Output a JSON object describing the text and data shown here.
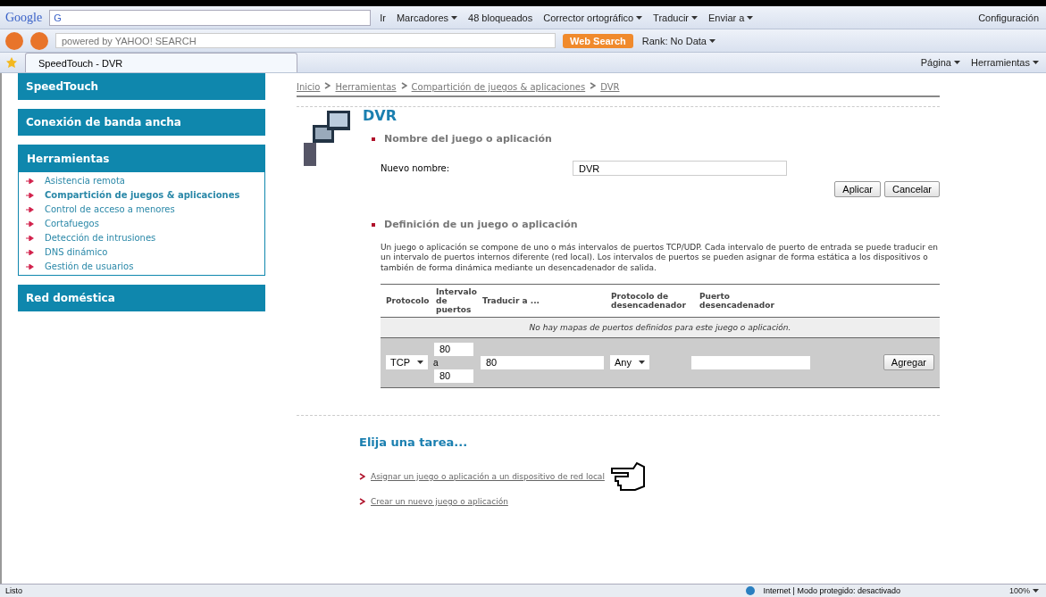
{
  "google_toolbar": {
    "logo": "Google",
    "search_label": "G",
    "go": "Ir",
    "items": [
      {
        "kind": "menu",
        "label": "Marcadores"
      },
      {
        "kind": "plain",
        "label": "48 bloqueados"
      },
      {
        "kind": "menu",
        "label": "Corrector ortográfico"
      },
      {
        "kind": "menu",
        "label": "Traducir"
      },
      {
        "kind": "menu",
        "label": "Enviar a"
      }
    ],
    "settings": "Configuración"
  },
  "yahoo_toolbar": {
    "search_placeholder": "powered by YAHOO! SEARCH",
    "search_button": "Web Search",
    "rank": "Rank: No Data"
  },
  "tab_bar": {
    "tabs": [
      {
        "label": "SpeedTouch - DVR",
        "selected": true
      }
    ],
    "commands": [
      "Página",
      "Herramientas"
    ]
  },
  "sidebar": {
    "sections": [
      {
        "title": "SpeedTouch",
        "expanded": false
      },
      {
        "title": "Conexión de banda ancha",
        "expanded": false
      },
      {
        "title": "Herramientas",
        "expanded": true,
        "items": [
          {
            "label": "Asistencia remota",
            "selected": false
          },
          {
            "label": "Compartición de juegos & aplicaciones",
            "selected": true
          },
          {
            "label": "Control de acceso a menores",
            "selected": false
          },
          {
            "label": "Cortafuegos",
            "selected": false
          },
          {
            "label": "Detección de intrusiones",
            "selected": false
          },
          {
            "label": "DNS dinámico",
            "selected": false
          },
          {
            "label": "Gestión de usuarios",
            "selected": false
          }
        ]
      },
      {
        "title": "Red doméstica",
        "expanded": false
      }
    ]
  },
  "breadcrumb": [
    "Inicio",
    "Herramientas",
    "Compartición de juegos & aplicaciones",
    "DVR"
  ],
  "page_title": "DVR",
  "name_section": {
    "heading": "Nombre del juego o aplicación",
    "label": "Nuevo nombre:",
    "value": "DVR",
    "buttons": [
      "Aplicar",
      "Cancelar"
    ]
  },
  "definition_section": {
    "heading": "Definición de un juego o aplicación",
    "description": "Un juego o aplicación se compone de uno o más intervalos de puertos TCP/UDP. Cada intervalo de puerto de entrada se puede traducir en un intervalo de puertos internos diferente (red local). Los intervalos de puertos se pueden asignar de forma estática a los dispositivos o también de forma dinámica mediante un desencadenador de salida.",
    "table": {
      "columns": [
        "Protocolo",
        "Intervalo de puertos",
        "Traducir a ...",
        "Protocolo de desencadenador",
        "Puerto desencadenador"
      ],
      "empty_message": "No hay mapas de puertos definidos para este juego o aplicación.",
      "new_row": {
        "protocol": "TCP",
        "port_from": "80",
        "range_separator": "a",
        "port_to": "80",
        "translate_to": "80",
        "trigger_protocol": "Any",
        "button": "Agregar"
      }
    }
  },
  "tasks": {
    "heading": "Elija una tarea...",
    "links": [
      "Asignar un juego o aplicación a un dispositivo de red local",
      "Crear un nuevo juego o aplicación"
    ]
  },
  "status_bar": {
    "text": "Listo",
    "zone": "Internet | Modo protegido: desactivado",
    "zoom": "100%"
  }
}
